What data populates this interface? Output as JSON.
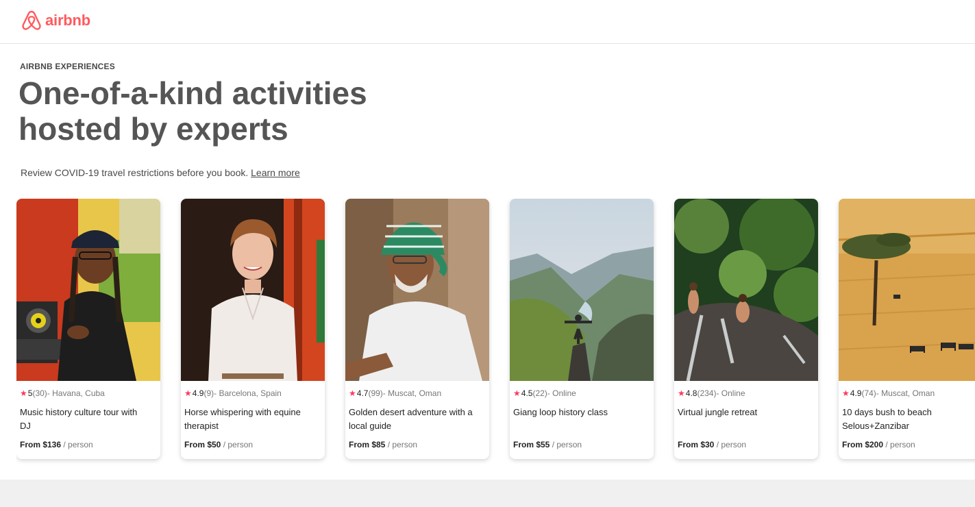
{
  "brand": {
    "name": "airbnb",
    "color": "#ff5a5f"
  },
  "hero": {
    "eyebrow": "AIRBNB EXPERIENCES",
    "title_line1": "One-of-a-kind activities",
    "title_line2": "hosted by experts"
  },
  "notice": {
    "text": "Review COVID-19 travel restrictions before you book.",
    "link": "Learn more"
  },
  "cards": [
    {
      "rating": "5",
      "reviews": "(30)",
      "location": " - Havana, Cuba",
      "title": "Music history culture tour with DJ",
      "price": "From $136",
      "unit": " / person"
    },
    {
      "rating": "4.9",
      "reviews": "(9)",
      "location": " - Barcelona, Spain",
      "title": "Horse whispering with equine therapist",
      "price": "From $50",
      "unit": " / person"
    },
    {
      "rating": "4.7",
      "reviews": "(99)",
      "location": " - Muscat, Oman",
      "title": "Golden desert adventure with a local guide",
      "price": "From $85",
      "unit": " / person"
    },
    {
      "rating": "4.5",
      "reviews": "(22)",
      "location": " - Online",
      "title": "Giang loop history class",
      "price": "From $55",
      "unit": " / person"
    },
    {
      "rating": "4.8",
      "reviews": "(234)",
      "location": " - Online",
      "title": "Virtual jungle retreat",
      "price": "From $30",
      "unit": " / person"
    },
    {
      "rating": "4.9",
      "reviews": "(74)",
      "location": " - Muscat, Oman",
      "title": "10 days bush to beach Selous+Zanzibar",
      "price": "From $200",
      "unit": " / person"
    }
  ],
  "colors": {
    "star": "#ff385c",
    "heading": "#555555",
    "text": "#484848"
  }
}
